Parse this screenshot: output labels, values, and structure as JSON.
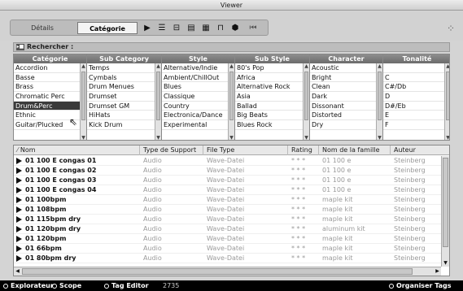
{
  "window": {
    "title": "Viewer"
  },
  "tabs": {
    "details": "Détails",
    "categorie": "Catégorie"
  },
  "toolbar_icons": [
    "play-icon",
    "filter-icon",
    "filter-bracket-icon",
    "list-icon",
    "grid-icon",
    "columns-icon",
    "globe-icon",
    "rewind-icon"
  ],
  "search": {
    "label": "Rechercher :"
  },
  "filters": {
    "columns": [
      {
        "header": "Catégorie",
        "items": [
          "Accordion",
          "Basse",
          "Brass",
          "Chromatic Perc",
          "Drum&Perc",
          "Ethnic",
          "Guitar/Plucked"
        ],
        "selected": 4
      },
      {
        "header": "Sub Category",
        "items": [
          "Temps",
          "Cymbals",
          "Drum Menues",
          "Drumset",
          "Drumset GM",
          "HiHats",
          "Kick Drum"
        ],
        "selected": -1
      },
      {
        "header": "Style",
        "items": [
          "Alternative/Indie",
          "Ambient/ChillOut",
          "Blues",
          "Classique",
          "Country",
          "Electronica/Dance",
          "Experimental"
        ],
        "selected": -1
      },
      {
        "header": "Sub Style",
        "items": [
          "80's Pop",
          "Africa",
          "Alternative Rock",
          "Asia",
          "Ballad",
          "Big Beats",
          "Blues Rock"
        ],
        "selected": -1
      },
      {
        "header": "Character",
        "items": [
          "Acoustic",
          "Bright",
          "Clean",
          "Dark",
          "Dissonant",
          "Distorted",
          "Dry"
        ],
        "selected": -1
      },
      {
        "header": "Tonalité",
        "items": [
          "",
          "C",
          "C#/Db",
          "D",
          "D#/Eb",
          "E",
          "F"
        ],
        "selected": -1
      }
    ]
  },
  "results": {
    "headers": [
      "Nom",
      "Type de Support",
      "File Type",
      "Rating",
      "Nom de la famille",
      "Auteur"
    ],
    "rows": [
      [
        "01 100 E congas 01",
        "Audio",
        "Wave-Datei",
        "* * *",
        "01 100 e",
        "Steinberg"
      ],
      [
        "01 100 E congas 02",
        "Audio",
        "Wave-Datei",
        "* * *",
        "01 100 e",
        "Steinberg"
      ],
      [
        "01 100 E congas 03",
        "Audio",
        "Wave-Datei",
        "* * *",
        "01 100 e",
        "Steinberg"
      ],
      [
        "01 100 E congas 04",
        "Audio",
        "Wave-Datei",
        "* * *",
        "01 100 e",
        "Steinberg"
      ],
      [
        "01 100bpm",
        "Audio",
        "Wave-Datei",
        "* * *",
        "maple kit",
        "Steinberg"
      ],
      [
        "01 108bpm",
        "Audio",
        "Wave-Datei",
        "* * *",
        "maple kit",
        "Steinberg"
      ],
      [
        "01 115bpm dry",
        "Audio",
        "Wave-Datei",
        "* * *",
        "maple kit",
        "Steinberg"
      ],
      [
        "01 120bpm dry",
        "Audio",
        "Wave-Datei",
        "* * *",
        "aluminum kit",
        "Steinberg"
      ],
      [
        "01 120bpm",
        "Audio",
        "Wave-Datei",
        "* * *",
        "maple kit",
        "Steinberg"
      ],
      [
        "01 66bpm",
        "Audio",
        "Wave-Datei",
        "* * *",
        "maple kit",
        "Steinberg"
      ],
      [
        "01 80bpm dry",
        "Audio",
        "Wave-Datei",
        "* * *",
        "maple kit",
        "Steinberg"
      ]
    ]
  },
  "status": {
    "explorateur": "Explorateur",
    "scope": "Scope",
    "tag_editor": "Tag Editor",
    "count": "2735",
    "organiser": "Organiser Tags"
  }
}
